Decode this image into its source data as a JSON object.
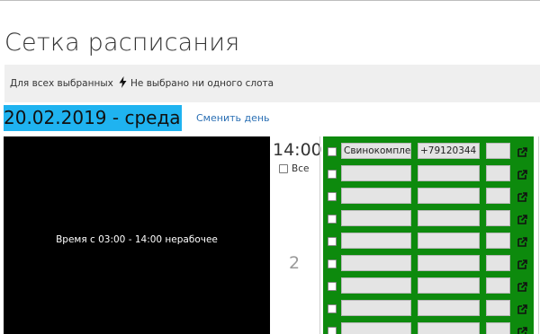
{
  "page": {
    "title": "Сетка расписания"
  },
  "toolbar": {
    "all_selected_label": "Для всех выбранных",
    "none_selected_label": "Не выбрано ни одного слота"
  },
  "day": {
    "date_label": "20.02.2019 - среда",
    "change_day_link": "Сменить день"
  },
  "nonwork_text": "Время с 03:00 - 14:00 нерабочее",
  "schedule": {
    "time_label": "14:00",
    "all_label": "Все",
    "number_label": "2",
    "rows": [
      {
        "name": "Свинокомпле",
        "phone": "+79120344",
        "extra": ""
      },
      {
        "name": "",
        "phone": "",
        "extra": ""
      },
      {
        "name": "",
        "phone": "",
        "extra": ""
      },
      {
        "name": "",
        "phone": "",
        "extra": ""
      },
      {
        "name": "",
        "phone": "",
        "extra": ""
      },
      {
        "name": "",
        "phone": "",
        "extra": ""
      },
      {
        "name": "",
        "phone": "",
        "extra": ""
      },
      {
        "name": "",
        "phone": "",
        "extra": ""
      },
      {
        "name": "",
        "phone": "",
        "extra": ""
      }
    ]
  },
  "colors": {
    "date_highlight": "#1fb3f0",
    "grid_green": "#0d8a0d",
    "nonwork_bg": "#000000",
    "link": "#2a6fb4"
  }
}
